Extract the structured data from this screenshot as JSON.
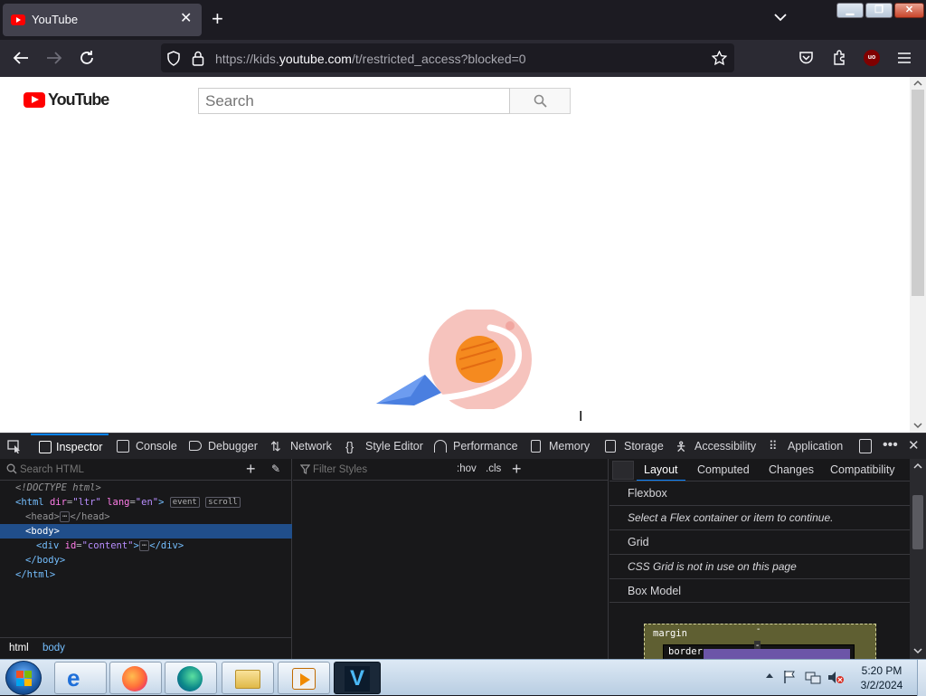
{
  "browser": {
    "tab_title": "YouTube",
    "url_prefix": "https://kids.",
    "url_domain": "youtube.com",
    "url_path": "/t/restricted_access?blocked=0"
  },
  "page": {
    "logo_text": "YouTube",
    "search_placeholder": "Search"
  },
  "devtools": {
    "tabs": [
      "Inspector",
      "Console",
      "Debugger",
      "Network",
      "Style Editor",
      "Performance",
      "Memory",
      "Storage",
      "Accessibility",
      "Application"
    ],
    "markup_search_placeholder": "Search HTML",
    "nodes": {
      "doctype": "<!DOCTYPE html>",
      "html_open_tag": "<html",
      "html_attr1": "dir",
      "html_val1": "\"ltr\"",
      "html_attr2": "lang",
      "html_val2": "\"en\"",
      "badge_event": "event",
      "badge_scroll": "scroll",
      "head": "<head>",
      "head_close": "</head>",
      "body": "<body>",
      "div_open": "<div",
      "div_attr": "id",
      "div_val": "\"content\"",
      "div_close": "</div>",
      "body_close": "</body>",
      "html_close": "</html>",
      "ellipsis": "⋯"
    },
    "breadcrumbs": [
      "html",
      "body"
    ],
    "rules_filter_placeholder": "Filter Styles",
    "rules_hov": ":hov",
    "rules_cls": ".cls",
    "layout_tabs": [
      "Layout",
      "Computed",
      "Changes",
      "Compatibility"
    ],
    "flexbox_title": "Flexbox",
    "flexbox_msg": "Select a Flex container or item to continue.",
    "grid_title": "Grid",
    "grid_msg": "CSS Grid is not in use on this page",
    "boxmodel_title": "Box Model",
    "boxmodel_margin": "margin",
    "boxmodel_border": "border",
    "boxmodel_dash": "-"
  },
  "taskbar": {
    "time": "5:20 PM",
    "date": "3/2/2024",
    "apps": [
      "start-orb",
      "internet-explorer",
      "firefox",
      "edge",
      "file-explorer",
      "media-player",
      "vegas"
    ]
  },
  "colors": {
    "accent": "#0a84ff",
    "youtube_red": "#ff0000"
  }
}
